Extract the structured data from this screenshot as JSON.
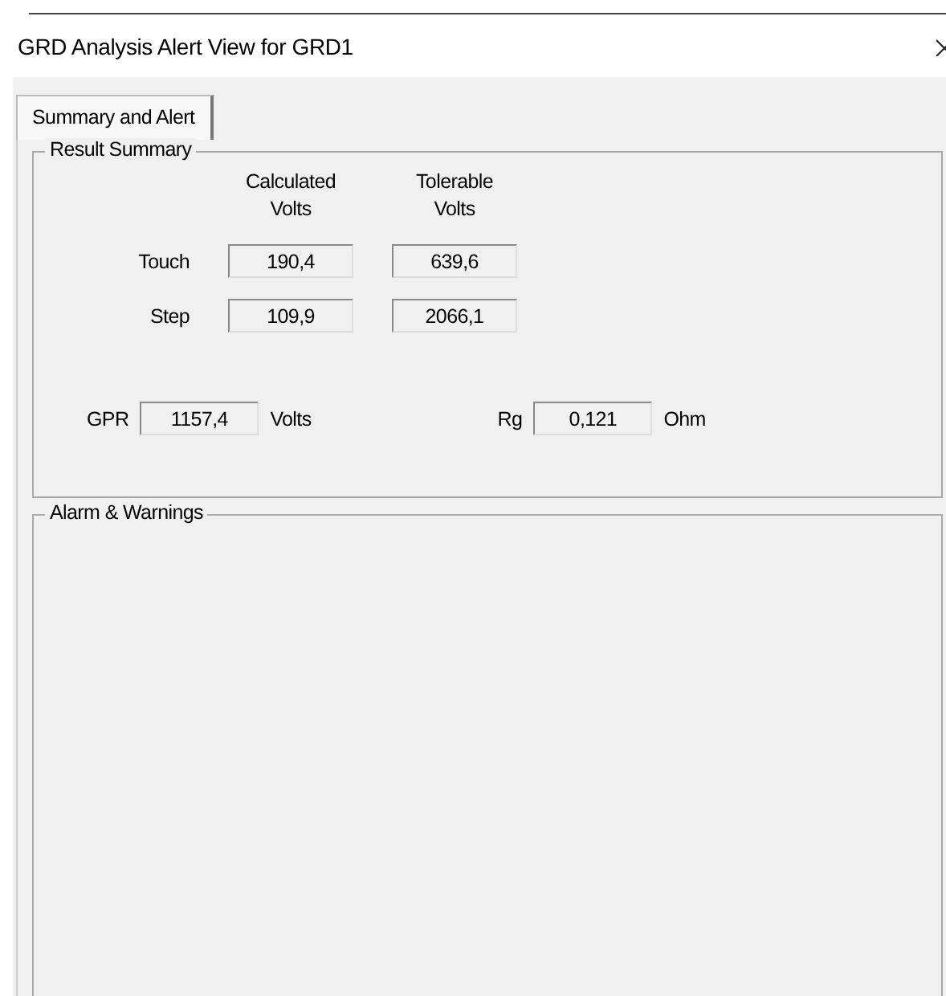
{
  "window": {
    "title": "GRD Analysis Alert View for GRD1"
  },
  "tabs": [
    {
      "label": "Summary and Alert",
      "selected": true
    }
  ],
  "result_summary": {
    "title": "Result Summary",
    "columns": [
      "Calculated\nVolts",
      "Tolerable\nVolts"
    ],
    "rows": [
      {
        "label": "Touch",
        "values": [
          "190,4",
          "639,6"
        ]
      },
      {
        "label": "Step",
        "values": [
          "109,9",
          "2066,1"
        ]
      }
    ],
    "gpr": {
      "label": "GPR",
      "value": "1157,4",
      "unit": "Volts"
    },
    "rg": {
      "label": "Rg",
      "value": "0,121",
      "unit": "Ohm"
    }
  },
  "alarms": {
    "title": "Alarm & Warnings"
  }
}
